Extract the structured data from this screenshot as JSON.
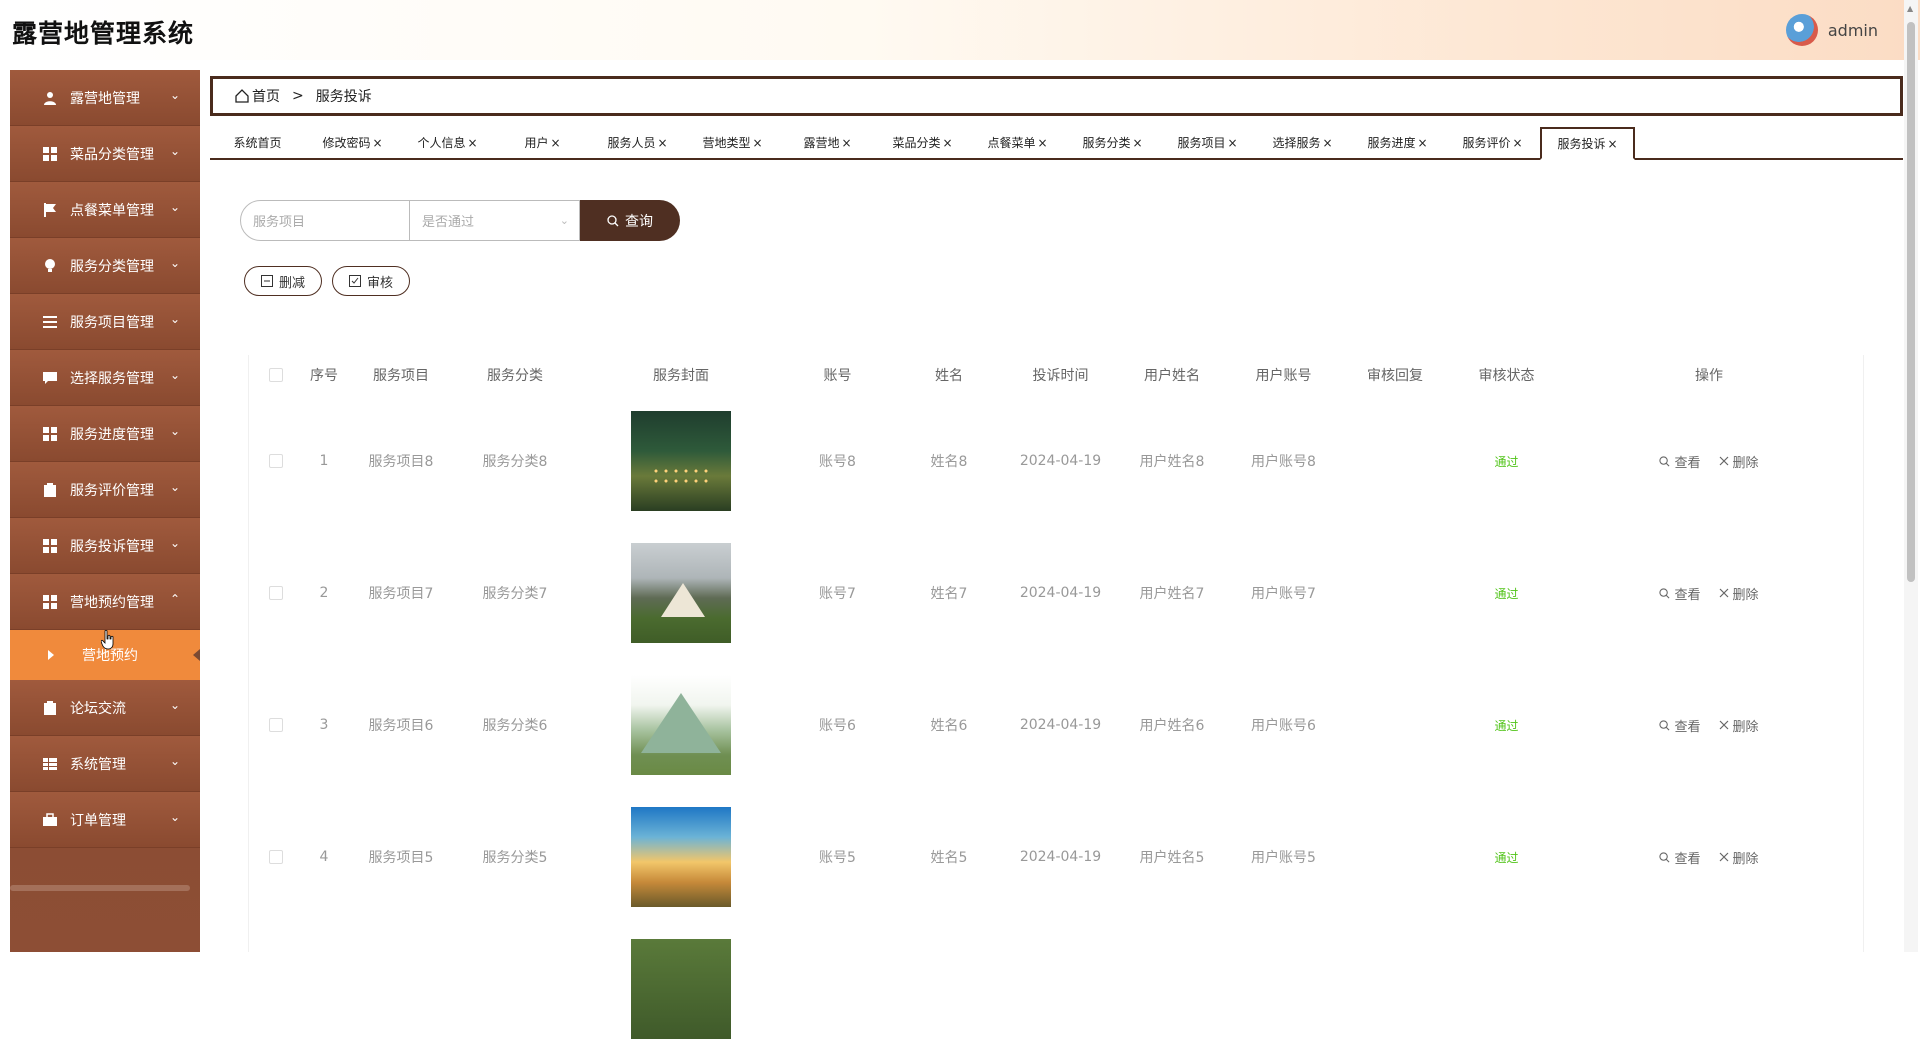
{
  "header": {
    "title": "露营地管理系统",
    "username": "admin"
  },
  "sidebar": {
    "items": [
      {
        "label": "露营地管理",
        "icon": "user-icon",
        "chevron": "⌄"
      },
      {
        "label": "菜品分类管理",
        "icon": "grid-icon",
        "chevron": "⌄"
      },
      {
        "label": "点餐菜单管理",
        "icon": "flag-icon",
        "chevron": "⌄"
      },
      {
        "label": "服务分类管理",
        "icon": "bulb-icon",
        "chevron": "⌄"
      },
      {
        "label": "服务项目管理",
        "icon": "list-icon",
        "chevron": "⌄"
      },
      {
        "label": "选择服务管理",
        "icon": "chat-icon",
        "chevron": "⌄"
      },
      {
        "label": "服务进度管理",
        "icon": "grid-icon",
        "chevron": "⌄"
      },
      {
        "label": "服务评价管理",
        "icon": "clipboard-icon",
        "chevron": "⌄"
      },
      {
        "label": "服务投诉管理",
        "icon": "grid-icon",
        "chevron": "⌄"
      },
      {
        "label": "营地预约管理",
        "icon": "grid-icon",
        "chevron": "⌃"
      },
      {
        "label": "论坛交流",
        "icon": "clipboard-icon",
        "chevron": "⌄"
      },
      {
        "label": "系统管理",
        "icon": "table-icon",
        "chevron": "⌄"
      },
      {
        "label": "订单管理",
        "icon": "briefcase-icon",
        "chevron": "⌄"
      }
    ],
    "sub_item": "营地预约"
  },
  "breadcrumb": {
    "home": "首页",
    "separator": ">",
    "current": "服务投诉"
  },
  "tabs": [
    {
      "label": "系统首页",
      "close": ""
    },
    {
      "label": "修改密码",
      "close": "×"
    },
    {
      "label": "个人信息",
      "close": "×"
    },
    {
      "label": "用户",
      "close": "×"
    },
    {
      "label": "服务人员",
      "close": "×"
    },
    {
      "label": "营地类型",
      "close": "×"
    },
    {
      "label": "露营地",
      "close": "×"
    },
    {
      "label": "菜品分类",
      "close": "×"
    },
    {
      "label": "点餐菜单",
      "close": "×"
    },
    {
      "label": "服务分类",
      "close": "×"
    },
    {
      "label": "服务项目",
      "close": "×"
    },
    {
      "label": "选择服务",
      "close": "×"
    },
    {
      "label": "服务进度",
      "close": "×"
    },
    {
      "label": "服务评价",
      "close": "×"
    },
    {
      "label": "服务投诉",
      "close": "×"
    }
  ],
  "search": {
    "item_placeholder": "服务项目",
    "status_placeholder": "是否通过",
    "button_label": "查询"
  },
  "actions": {
    "delete_label": "删减",
    "review_label": "审核"
  },
  "table": {
    "columns": [
      "序号",
      "服务项目",
      "服务分类",
      "服务封面",
      "账号",
      "姓名",
      "投诉时间",
      "用户姓名",
      "用户账号",
      "审核回复",
      "审核状态",
      "操作"
    ],
    "rows": [
      {
        "no": "1",
        "item": "服务项目8",
        "category": "服务分类8",
        "account": "账号8",
        "name": "姓名8",
        "time": "2024-04-19",
        "user_name": "用户姓名8",
        "user_account": "用户账号8",
        "reply": "",
        "status": "通过"
      },
      {
        "no": "2",
        "item": "服务项目7",
        "category": "服务分类7",
        "account": "账号7",
        "name": "姓名7",
        "time": "2024-04-19",
        "user_name": "用户姓名7",
        "user_account": "用户账号7",
        "reply": "",
        "status": "通过"
      },
      {
        "no": "3",
        "item": "服务项目6",
        "category": "服务分类6",
        "account": "账号6",
        "name": "姓名6",
        "time": "2024-04-19",
        "user_name": "用户姓名6",
        "user_account": "用户账号6",
        "reply": "",
        "status": "通过"
      },
      {
        "no": "4",
        "item": "服务项目5",
        "category": "服务分类5",
        "account": "账号5",
        "name": "姓名5",
        "time": "2024-04-19",
        "user_name": "用户姓名5",
        "user_account": "用户账号5",
        "reply": "",
        "status": "通过"
      }
    ],
    "view_label": "查看",
    "delete_label": "删除"
  },
  "colors": {
    "brand_dark": "#4f2f22",
    "sidebar": "#8f4d33",
    "active_sub": "#f08a3c",
    "status_ok": "#52c41a"
  }
}
